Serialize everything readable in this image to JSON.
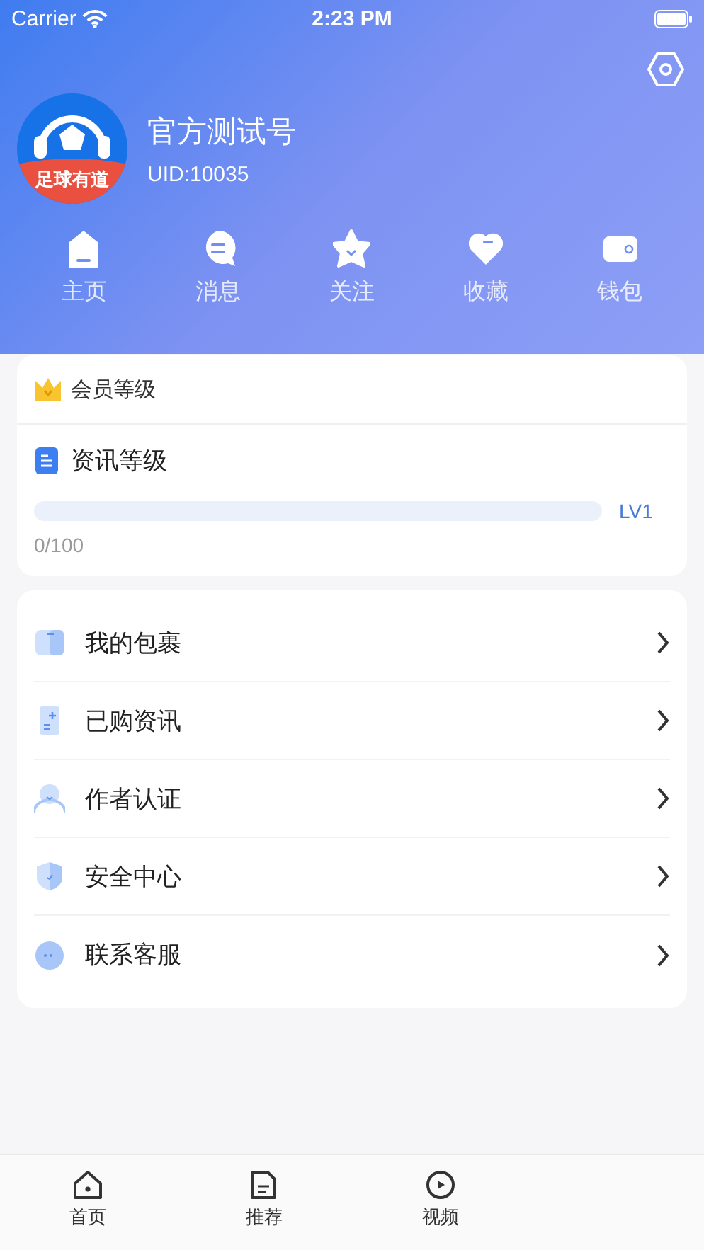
{
  "status_bar": {
    "carrier": "Carrier",
    "time": "2:23 PM"
  },
  "profile": {
    "avatar_label": "足球有道",
    "name": "官方测试号",
    "uid": "UID:10035"
  },
  "quick_nav": [
    {
      "kind": "home",
      "label": "主页"
    },
    {
      "kind": "message",
      "label": "消息"
    },
    {
      "kind": "star",
      "label": "关注"
    },
    {
      "kind": "heart",
      "label": "收藏"
    },
    {
      "kind": "wallet",
      "label": "钱包"
    }
  ],
  "level_card": {
    "title": "会员等级",
    "subtitle": "资讯等级",
    "level": 0,
    "badge": "LV1",
    "progress_text": "0/100"
  },
  "menu": [
    {
      "kind": "box",
      "label": "我的包裹"
    },
    {
      "kind": "doc",
      "label": "已购资讯"
    },
    {
      "kind": "person",
      "label": "作者认证"
    },
    {
      "kind": "shield",
      "label": "安全中心"
    },
    {
      "kind": "chat",
      "label": "联系客服"
    }
  ],
  "tab_bar": [
    {
      "kind": "home",
      "label": "首页"
    },
    {
      "kind": "doc",
      "label": "推荐"
    },
    {
      "kind": "play",
      "label": "视频"
    }
  ]
}
